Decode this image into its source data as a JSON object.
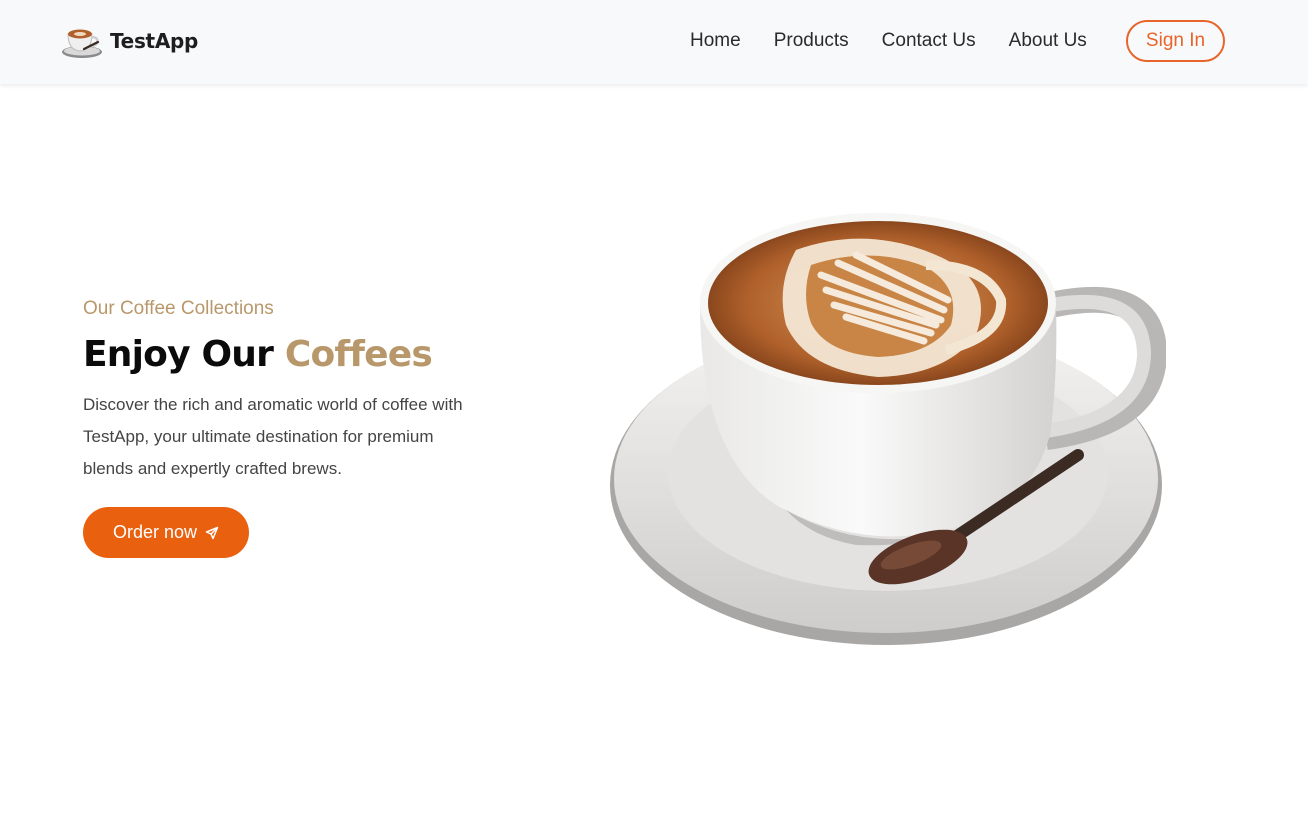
{
  "header": {
    "brand": "TestApp",
    "nav": [
      {
        "label": "Home"
      },
      {
        "label": "Products"
      },
      {
        "label": "Contact Us"
      },
      {
        "label": "About Us"
      }
    ],
    "signin_label": "Sign In"
  },
  "hero": {
    "eyebrow": "Our Coffee Collections",
    "headline_main": "Enjoy Our ",
    "headline_accent": "Coffees",
    "description": "Discover the rich and aromatic world of coffee with TestApp, your ultimate destination for premium blends and expertly crafted brews.",
    "cta_label": "Order now",
    "cta_icon": "send-icon",
    "image": "coffee-cup-latte-art"
  },
  "colors": {
    "accent": "#e9600f",
    "gold": "#b8986a",
    "navbar_bg": "#f8f9fb"
  }
}
